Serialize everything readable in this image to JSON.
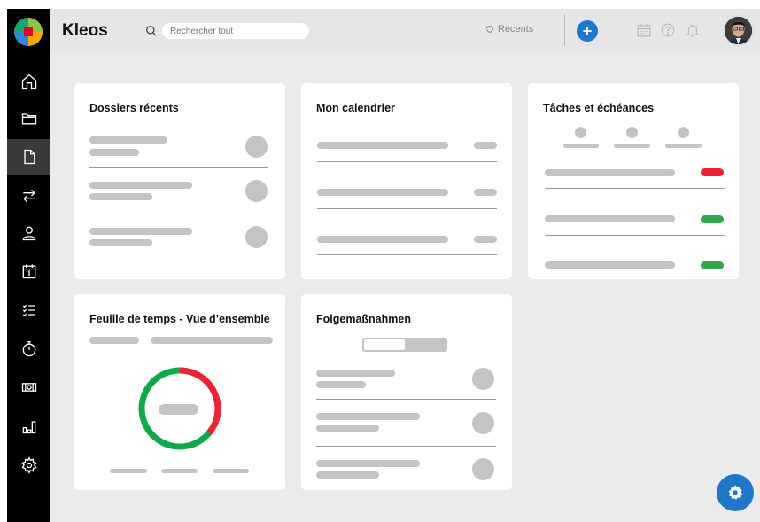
{
  "app": {
    "title": "Kleos"
  },
  "search": {
    "placeholder": "Rechercher tout"
  },
  "header": {
    "recents_label": "Récents"
  },
  "sidebar": {
    "items": [
      {
        "icon": "home-icon"
      },
      {
        "icon": "folder-icon"
      },
      {
        "icon": "document-icon",
        "active": true
      },
      {
        "icon": "transfer-icon"
      },
      {
        "icon": "contact-icon"
      },
      {
        "icon": "calendar-icon"
      },
      {
        "icon": "task-list-icon"
      },
      {
        "icon": "stopwatch-icon"
      },
      {
        "icon": "billing-icon"
      },
      {
        "icon": "reports-icon"
      },
      {
        "icon": "settings-icon"
      }
    ]
  },
  "cards": {
    "recent_files": {
      "title": "Dossiers récents"
    },
    "calendar": {
      "title": "Mon calendrier"
    },
    "tasks": {
      "title": "Tâches et échéances",
      "statuses": [
        "red",
        "green",
        "green"
      ]
    },
    "timesheet": {
      "title": "Feuille de temps - Vue d’ensemble",
      "donut_green_fraction": 0.64
    },
    "followups": {
      "title": "Folgemaßnahmen"
    }
  },
  "colors": {
    "accent": "#1e77c9",
    "red": "#ee2233",
    "green": "#2ea84a",
    "donut_green": "#12a84a",
    "donut_red": "#ee2233",
    "placeholder": "#c4c4c4"
  }
}
